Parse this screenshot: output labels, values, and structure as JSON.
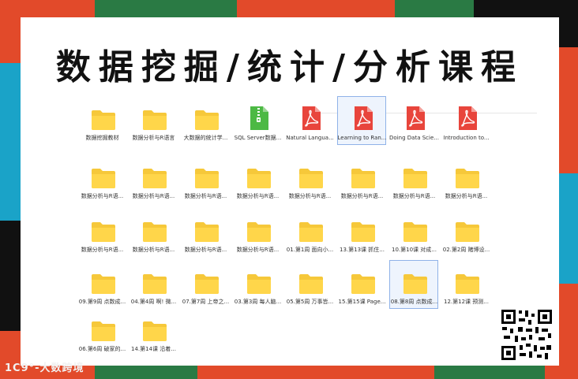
{
  "title": "数据挖掘/统计/分析课程",
  "watermark": "1C9°-大数跨境",
  "files": [
    {
      "type": "folder",
      "label": "数据挖掘教材"
    },
    {
      "type": "folder",
      "label": "数据分析与R语言"
    },
    {
      "type": "folder",
      "label": "大数据的统计学..."
    },
    {
      "type": "zip",
      "label": "SQL Server数据..."
    },
    {
      "type": "pdf",
      "label": "Natural Langua..."
    },
    {
      "type": "pdf",
      "label": "Learning to Ran...",
      "selected": true
    },
    {
      "type": "pdf",
      "label": "Doing Data Scie..."
    },
    {
      "type": "pdf",
      "label": "Introduction to..."
    },
    {
      "type": "folder",
      "label": "数据分析与R语..."
    },
    {
      "type": "folder",
      "label": "数据分析与R语..."
    },
    {
      "type": "folder",
      "label": "数据分析与R语..."
    },
    {
      "type": "folder",
      "label": "数据分析与R语..."
    },
    {
      "type": "folder",
      "label": "数据分析与R语..."
    },
    {
      "type": "folder",
      "label": "数据分析与R语..."
    },
    {
      "type": "folder",
      "label": "数据分析与R语..."
    },
    {
      "type": "folder",
      "label": "数据分析与R语..."
    },
    {
      "type": "folder",
      "label": "数据分析与R语..."
    },
    {
      "type": "folder",
      "label": "数据分析与R语..."
    },
    {
      "type": "folder",
      "label": "数据分析与R语..."
    },
    {
      "type": "folder",
      "label": "数据分析与R语..."
    },
    {
      "type": "folder",
      "label": "01.第1周 面向小..."
    },
    {
      "type": "folder",
      "label": "13.第13课 抓住..."
    },
    {
      "type": "folder",
      "label": "10.第10课 对成..."
    },
    {
      "type": "folder",
      "label": "02.第2周 赌博设..."
    },
    {
      "type": "folder",
      "label": "09.第9周 点数成..."
    },
    {
      "type": "folder",
      "label": "04.第4周 啊! 微..."
    },
    {
      "type": "folder",
      "label": "07.第7周 上帝之..."
    },
    {
      "type": "folder",
      "label": "03.第3周 每人脑..."
    },
    {
      "type": "folder",
      "label": "05.第5周 万事皆..."
    },
    {
      "type": "folder",
      "label": "15.第15课 Page..."
    },
    {
      "type": "folder",
      "label": "08.第8周 点数成...",
      "selected": true
    },
    {
      "type": "folder",
      "label": "12.第12课 预测..."
    },
    {
      "type": "folder",
      "label": "06.第6周 破家的..."
    },
    {
      "type": "folder",
      "label": "14.第14课 沿着..."
    }
  ]
}
